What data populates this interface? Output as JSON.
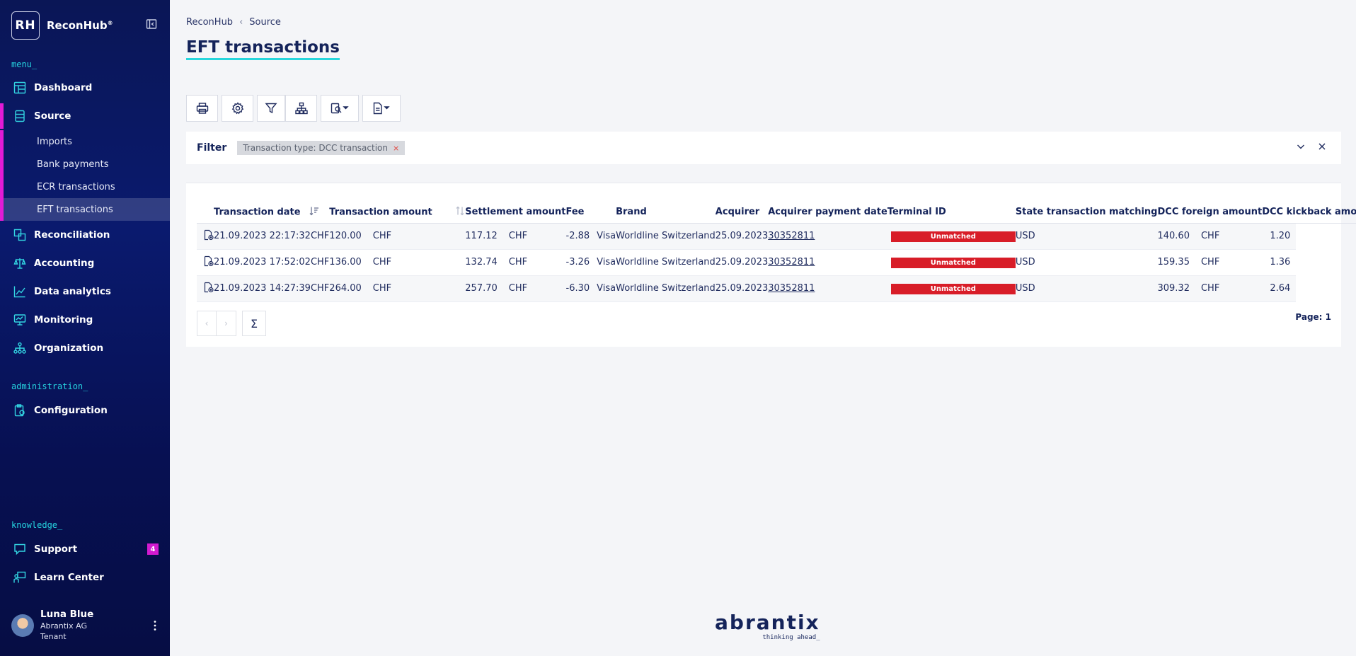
{
  "brand": {
    "logo": "RH",
    "name": "ReconHub",
    "mark": "®"
  },
  "sidebar": {
    "menu_label": "menu_",
    "admin_label": "administration_",
    "knowledge_label": "knowledge_",
    "items": [
      {
        "label": "Dashboard",
        "icon": "dashboard-icon"
      },
      {
        "label": "Source",
        "icon": "database-icon"
      },
      {
        "label": "Reconciliation",
        "icon": "reconciliation-icon"
      },
      {
        "label": "Accounting",
        "icon": "scale-icon"
      },
      {
        "label": "Data analytics",
        "icon": "chart-line-icon"
      },
      {
        "label": "Monitoring",
        "icon": "monitor-icon"
      },
      {
        "label": "Organization",
        "icon": "org-tree-icon"
      }
    ],
    "source_sub": [
      "Imports",
      "Bank payments",
      "ECR transactions",
      "EFT transactions"
    ],
    "admin_items": [
      {
        "label": "Configuration",
        "icon": "clipboard-gear-icon"
      }
    ],
    "knowledge_items": [
      {
        "label": "Support",
        "icon": "chat-icon",
        "badge": "4"
      },
      {
        "label": "Learn Center",
        "icon": "teacher-icon"
      }
    ],
    "user": {
      "name": "Luna Blue",
      "company": "Abrantix AG",
      "role": "Tenant"
    }
  },
  "breadcrumb": [
    "ReconHub",
    "Source"
  ],
  "page_title": "EFT transactions",
  "filter": {
    "label": "Filter",
    "chip": "Transaction type: DCC transaction",
    "chip_close": "×"
  },
  "table": {
    "headers": [
      "Transaction date",
      "Transaction amount",
      "Settlement amount",
      "Fee",
      "Brand",
      "Acquirer",
      "Acquirer payment date",
      "Terminal ID",
      "State transaction matching",
      "DCC foreign amount",
      "DCC kickback amount"
    ],
    "rows": [
      {
        "date": "21.09.2023 22:17:32",
        "tx_cur": "CHF",
        "tx_amt": "120.00",
        "st_cur": "CHF",
        "st_amt": "117.12",
        "fee_cur": "CHF",
        "fee": "-2.88",
        "brand": "Visa",
        "acquirer": "Worldline Switzerland",
        "pay_date": "25.09.2023",
        "terminal": "30352811",
        "state": "Unmatched",
        "dcc_cur": "USD",
        "dcc_amt": "140.60",
        "kb_cur": "CHF",
        "kb_amt": "1.20"
      },
      {
        "date": "21.09.2023 17:52:02",
        "tx_cur": "CHF",
        "tx_amt": "136.00",
        "st_cur": "CHF",
        "st_amt": "132.74",
        "fee_cur": "CHF",
        "fee": "-3.26",
        "brand": "Visa",
        "acquirer": "Worldline Switzerland",
        "pay_date": "25.09.2023",
        "terminal": "30352811",
        "state": "Unmatched",
        "dcc_cur": "USD",
        "dcc_amt": "159.35",
        "kb_cur": "CHF",
        "kb_amt": "1.36"
      },
      {
        "date": "21.09.2023 14:27:39",
        "tx_cur": "CHF",
        "tx_amt": "264.00",
        "st_cur": "CHF",
        "st_amt": "257.70",
        "fee_cur": "CHF",
        "fee": "-6.30",
        "brand": "Visa",
        "acquirer": "Worldline Switzerland",
        "pay_date": "25.09.2023",
        "terminal": "30352811",
        "state": "Unmatched",
        "dcc_cur": "USD",
        "dcc_amt": "309.32",
        "kb_cur": "CHF",
        "kb_amt": "2.64"
      }
    ]
  },
  "pager": {
    "prev": "‹",
    "next": "›",
    "sum": "Σ",
    "page_info": "Page: 1"
  },
  "footer": {
    "name": "abrantix",
    "tagline": "thinking ahead_"
  },
  "colors": {
    "sidebar": "#0a1656",
    "accent_magenta": "#e21bd6",
    "accent_cyan": "#28d6dc",
    "unmatched": "#d81d28"
  }
}
